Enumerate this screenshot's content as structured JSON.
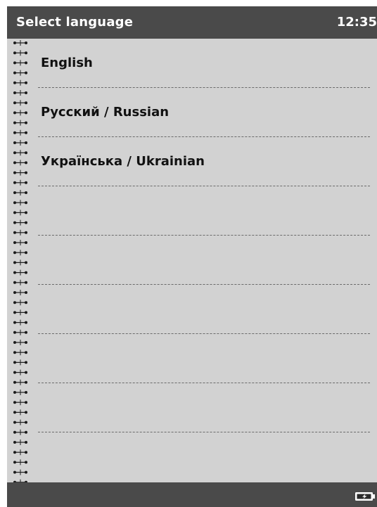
{
  "titlebar": {
    "title": "Select language",
    "clock": "12:35"
  },
  "languages": [
    {
      "label": "English"
    },
    {
      "label": "Русский / Russian"
    },
    {
      "label": "Українська / Ukrainian"
    },
    {
      "label": ""
    },
    {
      "label": ""
    },
    {
      "label": ""
    },
    {
      "label": ""
    },
    {
      "label": ""
    }
  ],
  "statusbar": {
    "battery_icon": "battery-charging-icon"
  },
  "colors": {
    "bar": "#4a4a4a",
    "background": "#d2d2d2",
    "text": "#111111"
  }
}
